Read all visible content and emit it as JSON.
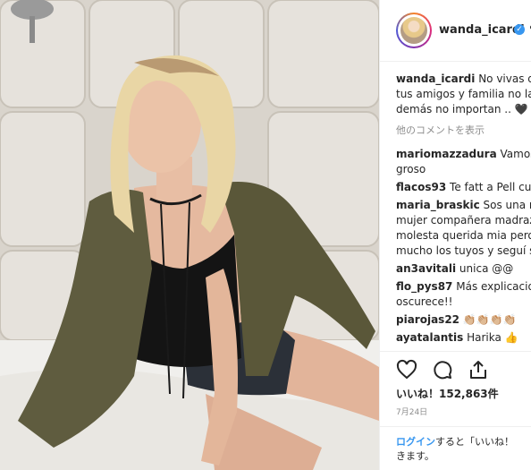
{
  "post": {
    "username": "wanda_icardi",
    "verified_mark": "✓",
    "separator": "•",
    "caption": {
      "user": "wanda_icardi",
      "lines": [
        "No vivas dar",
        "tus amigos y familia no las",
        "demás no importan .. 🖤"
      ]
    },
    "more_comments": "他のコメントを表示",
    "comments": [
      {
        "user": "mariomazzadura",
        "text": "Vamos M",
        "cont": "groso"
      },
      {
        "user": "flacos93",
        "text": "Te fatt a Pell cu D"
      },
      {
        "user": "maria_braskic",
        "text": "Sos una mu",
        "cont_lines": [
          "mujer compañera madraza",
          "molesta querida mia pero",
          "mucho los tuyos y seguí si"
        ]
      },
      {
        "user": "an3avitali",
        "text": "unica @@"
      },
      {
        "user": "flo_pys87",
        "text": "Más explicacior",
        "cont": "oscurece!!"
      },
      {
        "user": "piarojas22",
        "text": "👏🏼👏🏼👏🏼👏🏼"
      },
      {
        "user": "ayatalantis",
        "text": "Harika 👍"
      }
    ],
    "likes": "いいね！152,863件",
    "date": "7月24日",
    "login": {
      "link": "ログイン",
      "text_a": "すると「いいね！",
      "text_b": "きます。"
    }
  },
  "icons": [
    "heart-icon",
    "comment-icon",
    "share-icon",
    "verified-badge-icon",
    "avatar"
  ],
  "colors": {
    "accent_blue": "#3897f0",
    "text": "#262626",
    "muted": "#8e8e8e",
    "jacket": "#5e5b3e",
    "top": "#121212"
  }
}
